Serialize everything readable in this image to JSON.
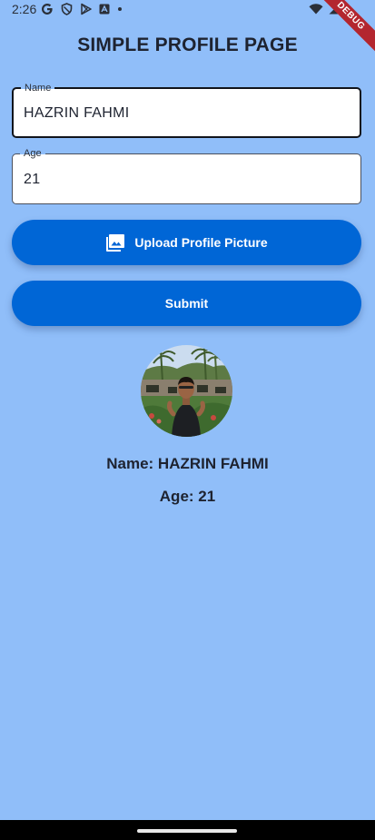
{
  "status_bar": {
    "time": "2:26",
    "icons_left": [
      "google-icon",
      "shield-icon",
      "play-store-icon",
      "app-icon",
      "dot-icon"
    ],
    "icons_right": [
      "wifi-icon",
      "signal-icon"
    ],
    "debug_banner": "DEBUG"
  },
  "page": {
    "title": "SIMPLE PROFILE PAGE",
    "background": "#90BEF9"
  },
  "form": {
    "name_field": {
      "label": "Name",
      "value": "HAZRIN FAHMI",
      "focused": true
    },
    "age_field": {
      "label": "Age",
      "value": "21"
    }
  },
  "buttons": {
    "upload_label": "Upload Profile Picture",
    "upload_icon": "photo-library-icon",
    "submit_label": "Submit",
    "color": "#0066D6"
  },
  "profile": {
    "name_line": "Name: HAZRIN FAHMI",
    "age_line": "Age: 21"
  }
}
